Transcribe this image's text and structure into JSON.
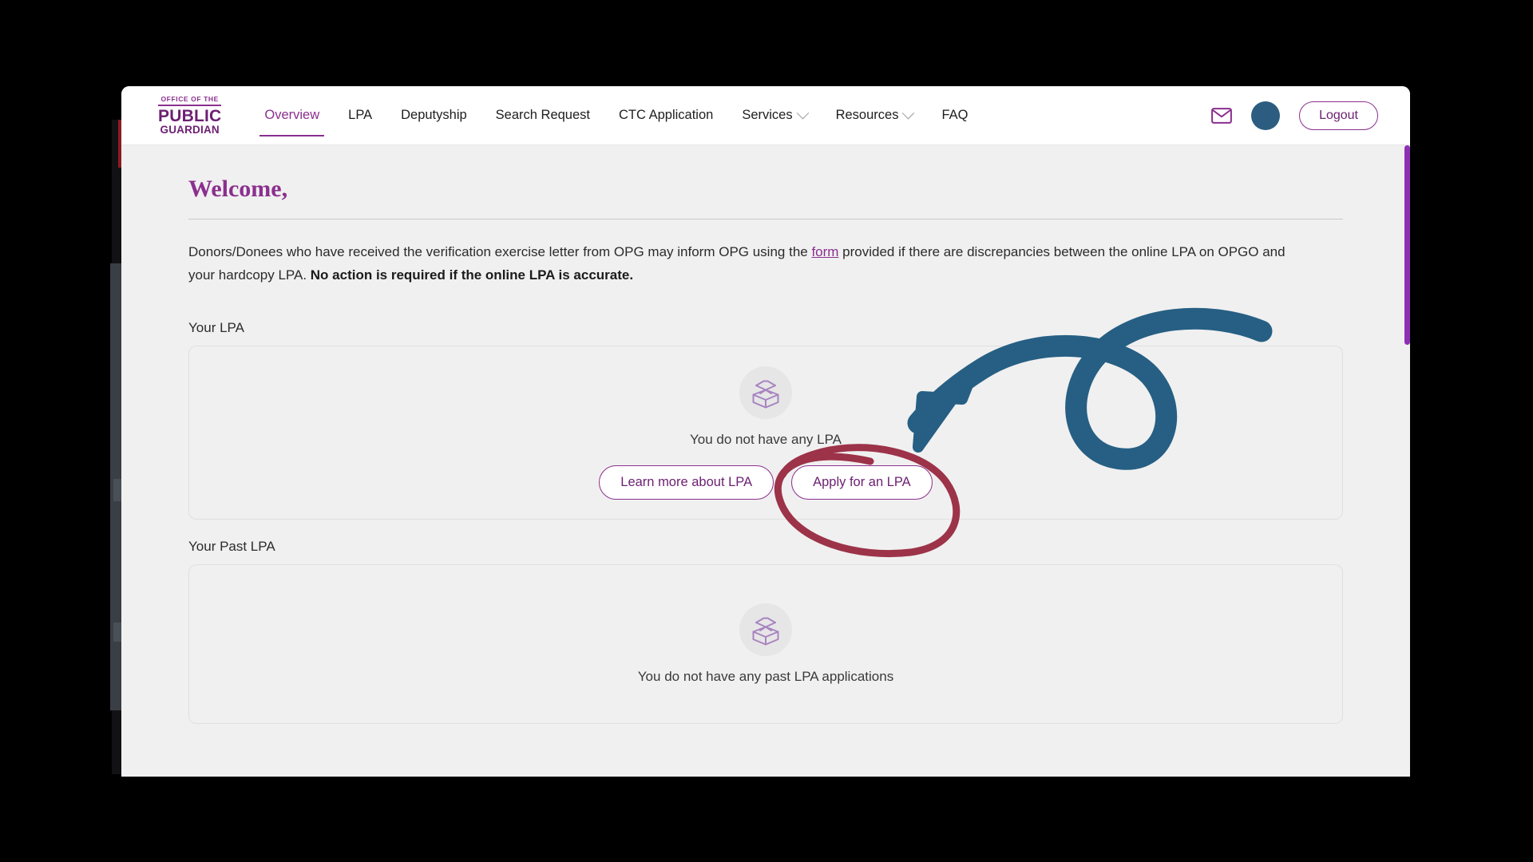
{
  "header": {
    "logo": {
      "line1": "OFFICE OF THE",
      "line2": "PUBLIC",
      "line3": "GUARDIAN"
    },
    "nav": [
      {
        "label": "Overview",
        "active": true,
        "has_dropdown": false
      },
      {
        "label": "LPA",
        "active": false,
        "has_dropdown": false
      },
      {
        "label": "Deputyship",
        "active": false,
        "has_dropdown": false
      },
      {
        "label": "Search Request",
        "active": false,
        "has_dropdown": false
      },
      {
        "label": "CTC Application",
        "active": false,
        "has_dropdown": false
      },
      {
        "label": "Services",
        "active": false,
        "has_dropdown": true
      },
      {
        "label": "Resources",
        "active": false,
        "has_dropdown": true
      },
      {
        "label": "FAQ",
        "active": false,
        "has_dropdown": false
      }
    ],
    "mail_icon": "envelope-icon",
    "avatar_label": "",
    "logout_label": "Logout"
  },
  "main": {
    "welcome_title": "Welcome,",
    "intro": {
      "part1": "Donors/Donees who have received the verification exercise letter from OPG may inform OPG using the ",
      "link_text": "form",
      "part2": " provided if there are discrepancies between the online LPA on OPGO and your hardcopy LPA. ",
      "bold_text": "No action is required if the online LPA is accurate."
    },
    "lpa_section": {
      "title": "Your LPA",
      "icon": "open-box-icon",
      "empty_text": "You do not have any LPA",
      "learn_more_label": "Learn more about LPA",
      "apply_label": "Apply for an LPA"
    },
    "past_lpa_section": {
      "title": "Your Past LPA",
      "icon": "open-box-icon",
      "empty_text": "You do not have any past LPA applications"
    }
  },
  "annotations": {
    "arrow": {
      "name": "blue-curly-arrow",
      "color": "#265f83",
      "points_to": "Apply for an LPA"
    },
    "circle": {
      "name": "red-highlight-circle",
      "color": "#9c3349",
      "encircles": "Apply for an LPA"
    }
  },
  "colors": {
    "brand_purple": "#8b2f8f",
    "logo_purple": "#6c1f72",
    "avatar_blue": "#2c5d80",
    "page_bg": "#f0f0f0",
    "annotation_blue": "#265f83",
    "annotation_red": "#9c3349",
    "scrollbar_purple": "#8e2fb4"
  }
}
